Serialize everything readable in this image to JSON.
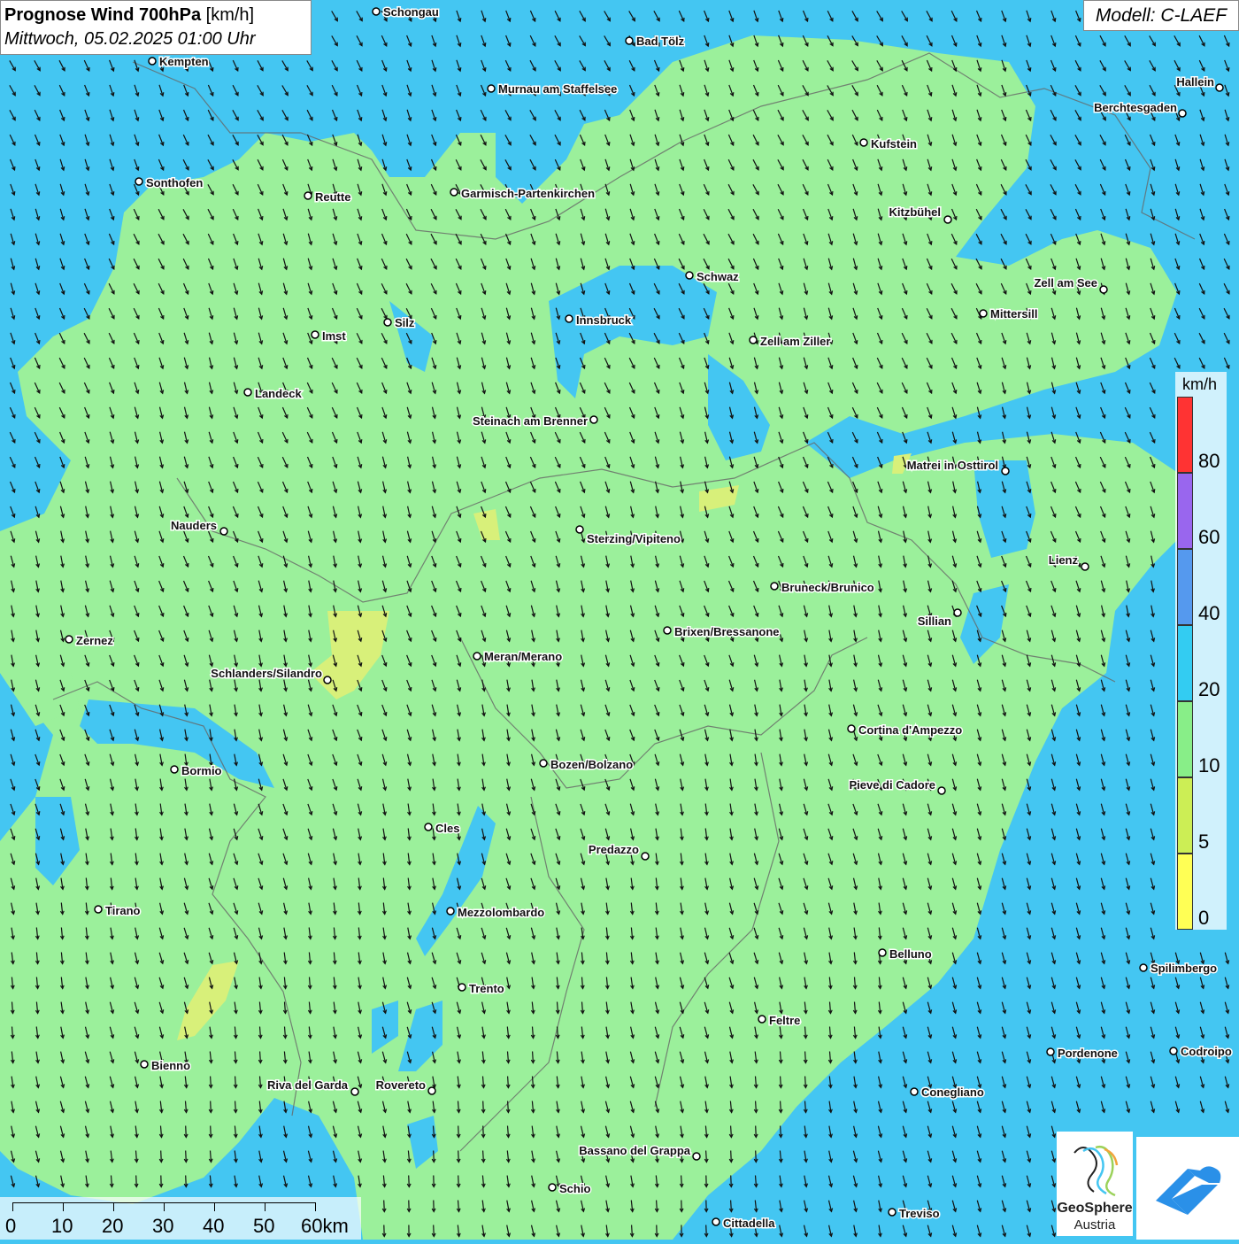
{
  "title": {
    "main_bold": "Prognose Wind 700hPa",
    "main_unit": "[km/h]",
    "datetime": "Mittwoch, 05.02.2025 01:00 Uhr"
  },
  "model": "Modell: C-LAEF",
  "legend": {
    "unit": "km/h",
    "labels": [
      "80",
      "60",
      "40",
      "20",
      "10",
      "5",
      "0"
    ],
    "colors": [
      "#ff3333",
      "#9966ee",
      "#5599ee",
      "#33ccf2",
      "#88ee88",
      "#ccee55",
      "#ffff55"
    ]
  },
  "scalebar": {
    "labels": [
      "0",
      "10",
      "20",
      "30",
      "40",
      "50",
      "60km"
    ]
  },
  "logos": {
    "geosphere_line1": "GeoSphere",
    "geosphere_line2": "Austria"
  },
  "colors": {
    "blue_band": "#44c6f2",
    "green_band": "#9bf09b",
    "yellow_band": "#d8f07a",
    "arrow": "#000000"
  },
  "cities": [
    {
      "name": "Schongau"
    },
    {
      "name": "Bad Tölz"
    },
    {
      "name": "Kempten"
    },
    {
      "name": "Murnau am Staffelsee"
    },
    {
      "name": "Hallein"
    },
    {
      "name": "Berchtesgaden"
    },
    {
      "name": "Kufstein"
    },
    {
      "name": "Sonthofen"
    },
    {
      "name": "Reutte"
    },
    {
      "name": "Garmisch-Partenkirchen"
    },
    {
      "name": "Kitzbühel"
    },
    {
      "name": "Schwaz"
    },
    {
      "name": "Zell am See"
    },
    {
      "name": "Mittersill"
    },
    {
      "name": "Innsbruck"
    },
    {
      "name": "Silz"
    },
    {
      "name": "Imst"
    },
    {
      "name": "Zell am Ziller"
    },
    {
      "name": "Landeck"
    },
    {
      "name": "Steinach am Brenner"
    },
    {
      "name": "Matrei in Osttirol"
    },
    {
      "name": "Nauders"
    },
    {
      "name": "Sterzing/Vipiteno"
    },
    {
      "name": "Lienz"
    },
    {
      "name": "Bruneck/Brunico"
    },
    {
      "name": "Sillian"
    },
    {
      "name": "Brixen/Bressanone"
    },
    {
      "name": "Zernez"
    },
    {
      "name": "Meran/Merano"
    },
    {
      "name": "Schlanders/Silandro"
    },
    {
      "name": "Cortina d'Ampezzo"
    },
    {
      "name": "Bozen/Bolzano"
    },
    {
      "name": "Bormio"
    },
    {
      "name": "Pieve di Cadore"
    },
    {
      "name": "Cles"
    },
    {
      "name": "Predazzo"
    },
    {
      "name": "Tirano"
    },
    {
      "name": "Mezzolombardo"
    },
    {
      "name": "Belluno"
    },
    {
      "name": "Spilimbergo"
    },
    {
      "name": "Trento"
    },
    {
      "name": "Feltre"
    },
    {
      "name": "Pordenone"
    },
    {
      "name": "Codroipo"
    },
    {
      "name": "Bienno"
    },
    {
      "name": "Riva del Garda"
    },
    {
      "name": "Rovereto"
    },
    {
      "name": "Conegliano"
    },
    {
      "name": "Bassano del Grappa"
    },
    {
      "name": "Schio"
    },
    {
      "name": "Treviso"
    },
    {
      "name": "Cittadella"
    }
  ]
}
